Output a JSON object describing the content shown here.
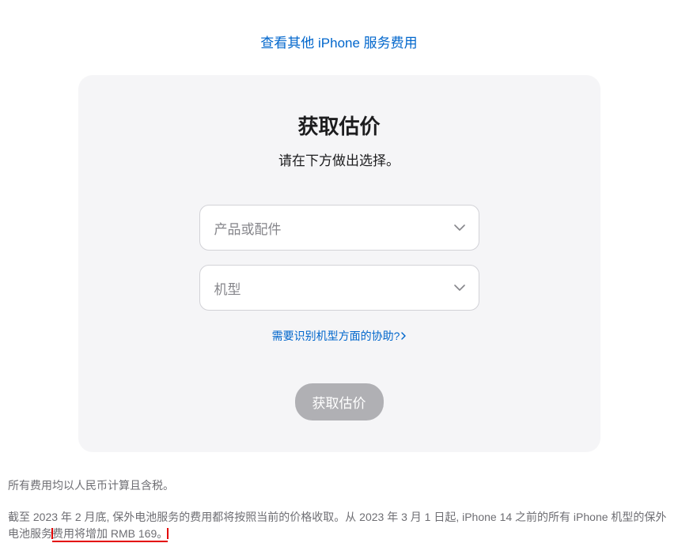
{
  "top_link": "查看其他 iPhone 服务费用",
  "card": {
    "title": "获取估价",
    "subtitle": "请在下方做出选择。",
    "select_product_placeholder": "产品或配件",
    "select_model_placeholder": "机型",
    "help_link": "需要识别机型方面的协助?",
    "submit_button": "获取估价"
  },
  "footer": {
    "line1": "所有费用均以人民币计算且含税。",
    "line2_prefix": "截至 2023 年 2 月底, 保外电池服务的费用都将按照当前的价格收取。从 2023 年 3 月 1 日起, iPhone 14 之前的所有 iPhone 机型的保外电池服务",
    "line2_highlight": "费用将增加 RMB 169。"
  }
}
